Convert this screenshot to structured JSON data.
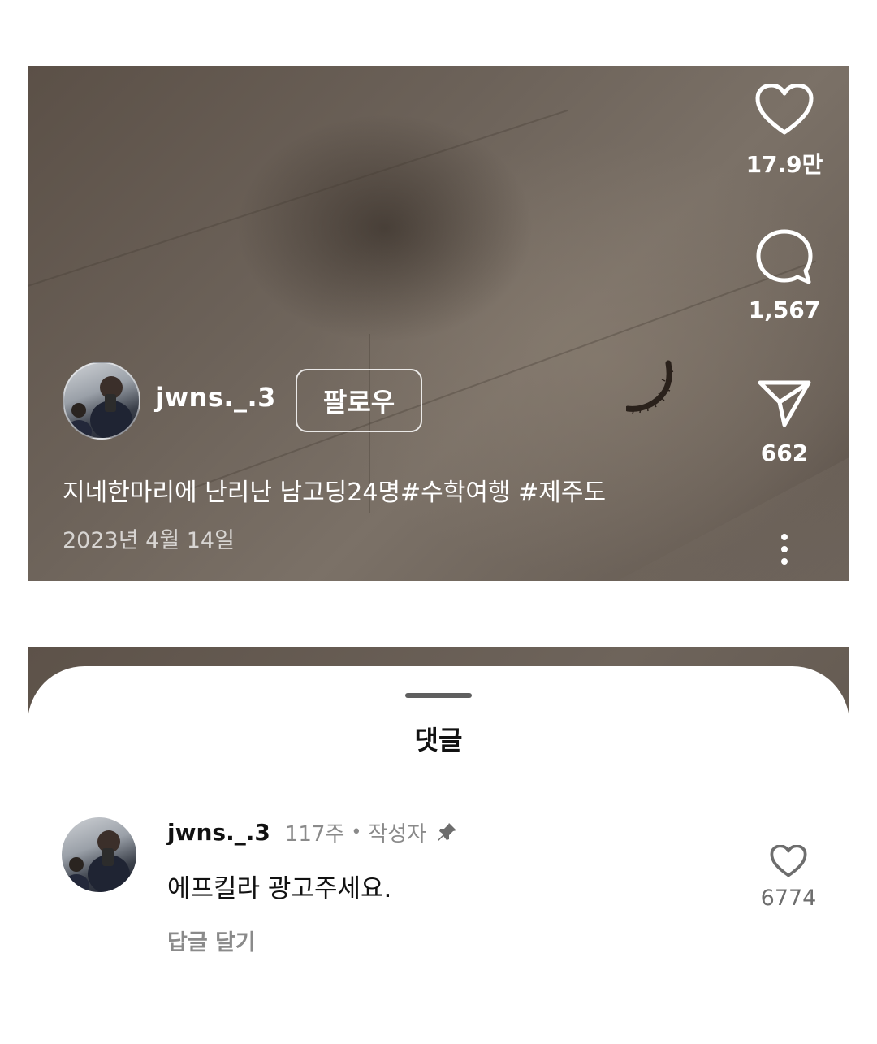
{
  "post": {
    "username": "jwns._.3",
    "follow_label": "팔로우",
    "caption": "지네한마리에 난리난 남고딩24명#수학여행 #제주도",
    "date": "2023년 4월 14일"
  },
  "actions": {
    "likes": "17.9만",
    "comments": "1,567",
    "shares": "662"
  },
  "comments_sheet": {
    "title": "댓글",
    "comment": {
      "username": "jwns._.3",
      "time": "117주",
      "separator": "•",
      "author_badge": "작성자",
      "text": "에프킬라 광고주세요.",
      "reply_label": "답글 달기",
      "like_count": "6774"
    }
  },
  "icons": {
    "like": "heart-outline-icon",
    "comment": "speech-bubble-icon",
    "share": "paper-plane-icon",
    "more": "vertical-dots-icon",
    "pin": "pin-icon",
    "comment_like": "heart-outline-icon"
  }
}
